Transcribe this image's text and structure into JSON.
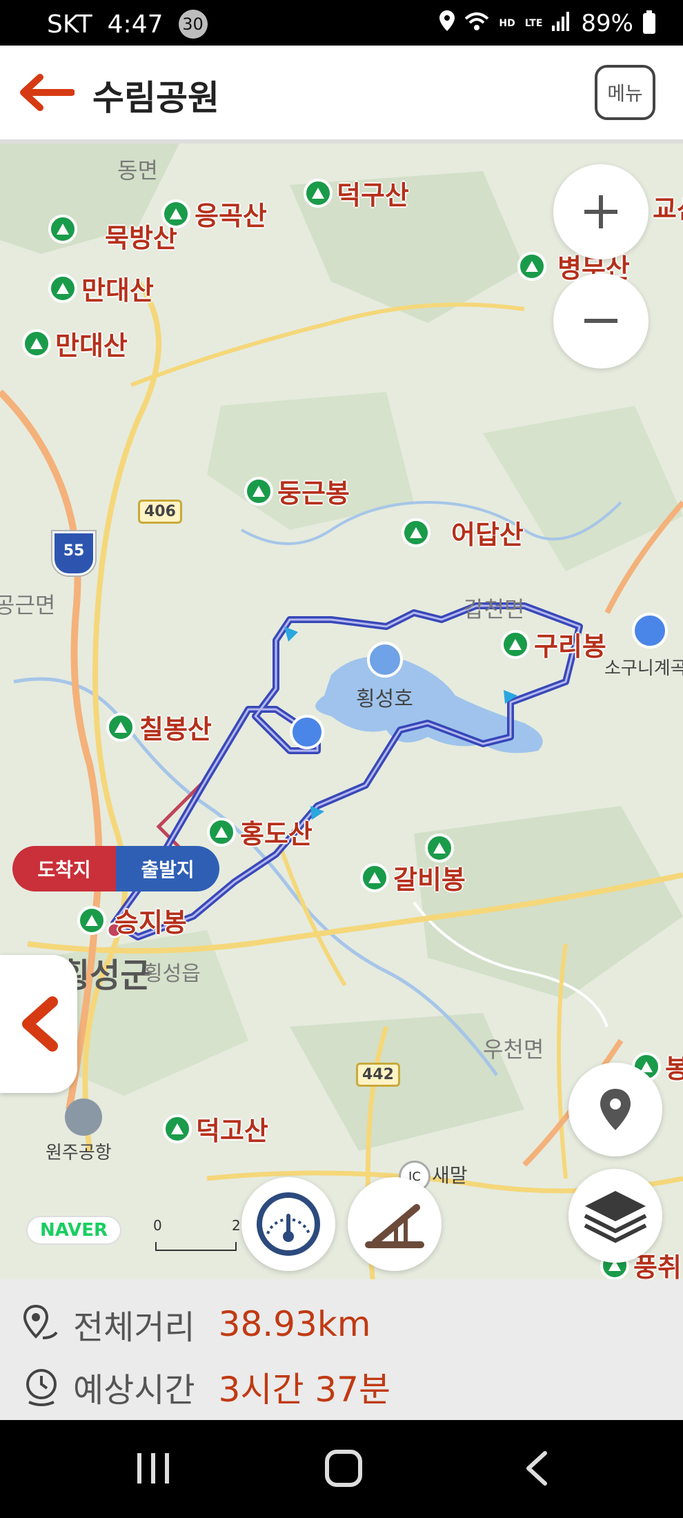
{
  "status": {
    "carrier": "SKT",
    "time": "4:47",
    "badge": "30",
    "battery": "89%",
    "net": "LTE",
    "hd": "HD"
  },
  "header": {
    "title": "수림공원",
    "menu_label": "메뉴"
  },
  "map": {
    "regions": [
      "동면",
      "공근면",
      "갑천면",
      "우천면",
      "횡성군",
      "횡성읍"
    ],
    "peaks": [
      "묵방산",
      "응곡산",
      "덕구산",
      "만대산",
      "만대산",
      "둥근봉",
      "어답산",
      "구리봉",
      "칠봉산",
      "홍도산",
      "갈비봉",
      "승지봉",
      "덕고산",
      "교산",
      "병무산",
      "봉",
      "풍취"
    ],
    "lake": "횡성호",
    "roads": [
      "406",
      "55",
      "442"
    ],
    "ic_label": "IC",
    "ic_name": "새말",
    "airport": "원주공항",
    "poi_right": "소구니계곡",
    "flags": {
      "arrival": "도착지",
      "departure": "출발지"
    },
    "logo": "NAVER",
    "scale_start": "0",
    "scale_end": "2"
  },
  "summary": {
    "distance_label": "전체거리",
    "distance_value": "38.93km",
    "time_label": "예상시간",
    "time_value": "3시간 37분"
  }
}
